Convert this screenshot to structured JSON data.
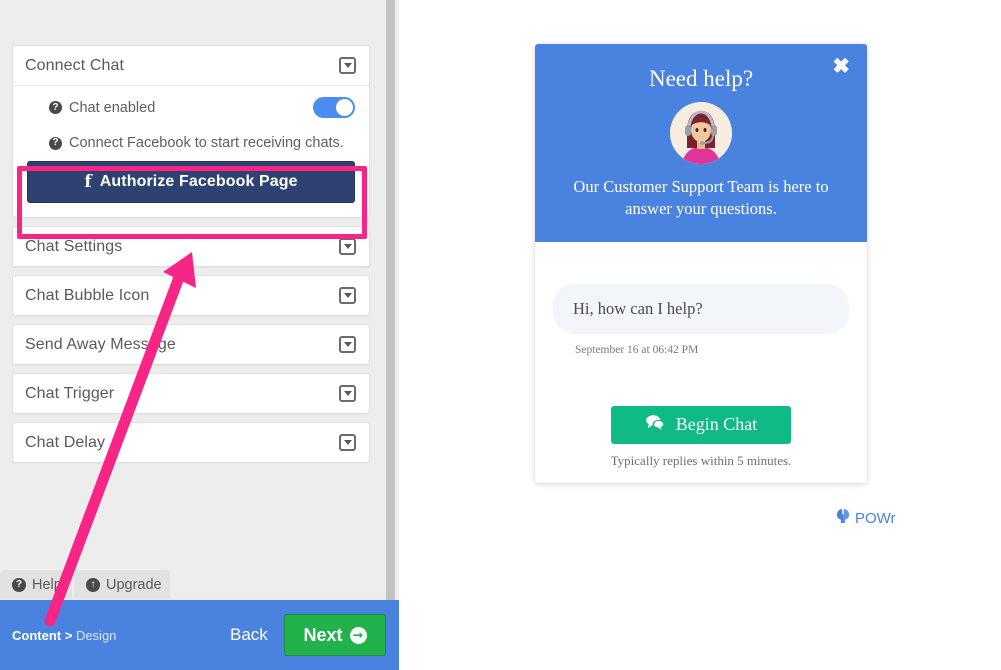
{
  "editor": {
    "accordion": [
      {
        "title": "Connect Chat",
        "caret": "caret-down-icon",
        "expanded": true,
        "toggle_label": "Chat enabled",
        "toggle_state": "on",
        "note": "Connect Facebook to start receiving chats.",
        "fb_button_label": "Authorize Facebook Page",
        "fb_button_icon": "facebook-f-icon"
      },
      {
        "title": "Chat Settings",
        "caret": "caret-down-icon",
        "expanded": false
      },
      {
        "title": "Chat Bubble Icon",
        "caret": "caret-down-icon",
        "expanded": false
      },
      {
        "title": "Send Away Message",
        "caret": "caret-down-icon",
        "expanded": false
      },
      {
        "title": "Chat Trigger",
        "caret": "caret-down-icon",
        "expanded": false
      },
      {
        "title": "Chat Delay",
        "caret": "caret-down-icon",
        "expanded": false
      }
    ],
    "tabs": [
      {
        "label": "Help",
        "icon": "question-circle-icon",
        "glyph": "?"
      },
      {
        "label": "Upgrade",
        "icon": "arrow-up-circle-icon",
        "glyph": "↑"
      }
    ],
    "navbar": {
      "breadcrumb_current": "Content >",
      "breadcrumb_next": "Design",
      "back_label": "Back",
      "next_label": "Next",
      "next_icon": "arrow-right-circle-icon",
      "next_glyph": "➜"
    },
    "help_glyph": "?"
  },
  "widget": {
    "close_icon": "close-x-icon",
    "close_glyph": "✖",
    "heading": "Need help?",
    "avatar": "support-agent-avatar",
    "subtext": "Our Customer Support Team is here to answer your questions.",
    "message": "Hi, how can I help?",
    "message_time": "September 16 at 06:42 PM",
    "begin_chat_label": "Begin Chat",
    "begin_chat_icon": "comments-icon",
    "reply_note": "Typically replies within 5 minutes."
  },
  "powr": {
    "label": "POWr",
    "icon": "powr-power-icon"
  },
  "colors": {
    "accent_blue": "#4a82e0",
    "facebook_navy": "#2e4272",
    "highlight_pink": "#f72585",
    "next_green": "#22b24c",
    "begin_chat_green": "#0fba86",
    "panel_gray": "#ededed"
  }
}
